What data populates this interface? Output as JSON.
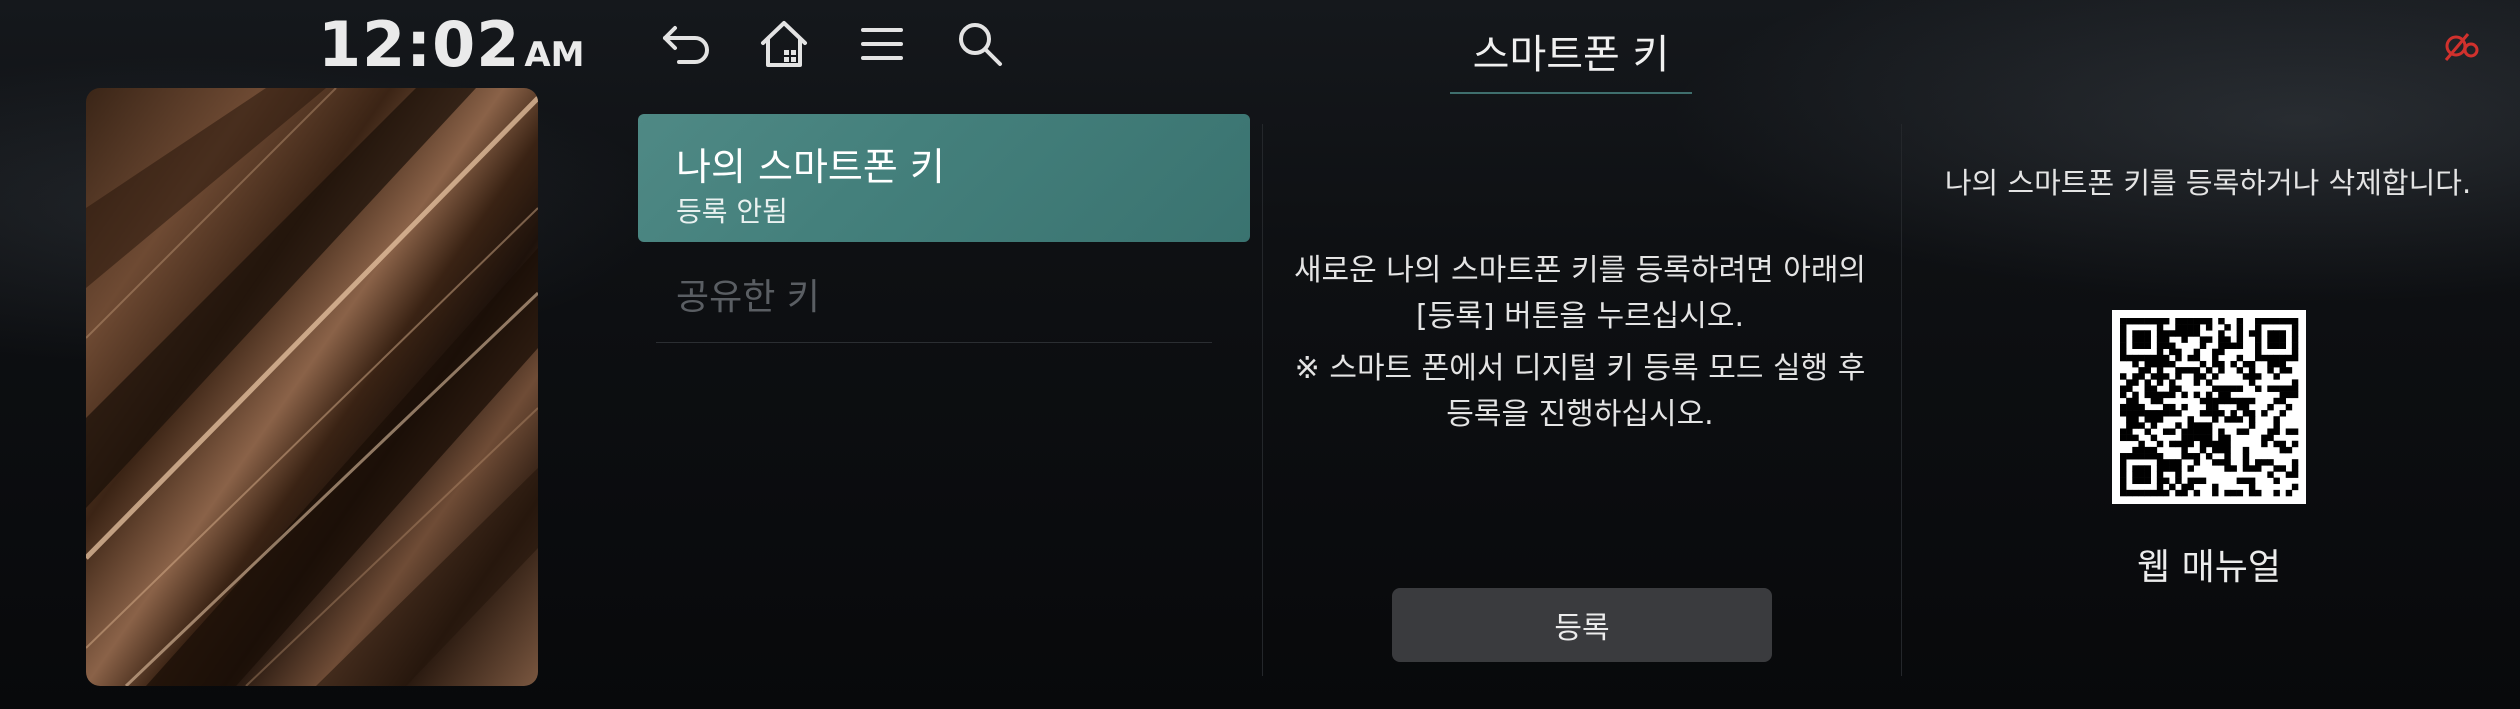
{
  "clock": {
    "time": "12:02",
    "ampm": "AM"
  },
  "nav": {
    "icons": [
      "back-icon",
      "home-icon",
      "menu-icon",
      "search-icon"
    ]
  },
  "header": {
    "title": "스마트폰 키"
  },
  "status_icon": "smartkey-status-icon",
  "list": {
    "items": [
      {
        "title": "나의 스마트폰 키",
        "subtitle": "등록 안됨",
        "selected": true
      },
      {
        "title": "공유한 키",
        "subtitle": "",
        "selected": false
      }
    ]
  },
  "middle": {
    "line1": "새로운 나의 스마트폰 키를 등록하려면 아래의",
    "line2": "[등록] 버튼을 누르십시오.",
    "line3": "※ 스마트 폰에서 디지털 키 등록 모드 실행 후",
    "line4": "등록을 진행하십시오.",
    "register_label": "등록"
  },
  "right": {
    "description": "나의 스마트폰 키를 등록하거나 삭제합니다.",
    "web_manual_label": "웹 매뉴얼"
  },
  "colors": {
    "accent": "#4a8581",
    "background": "#0a0b0d",
    "button": "#3a3b3e",
    "status_red": "#d0312d"
  }
}
